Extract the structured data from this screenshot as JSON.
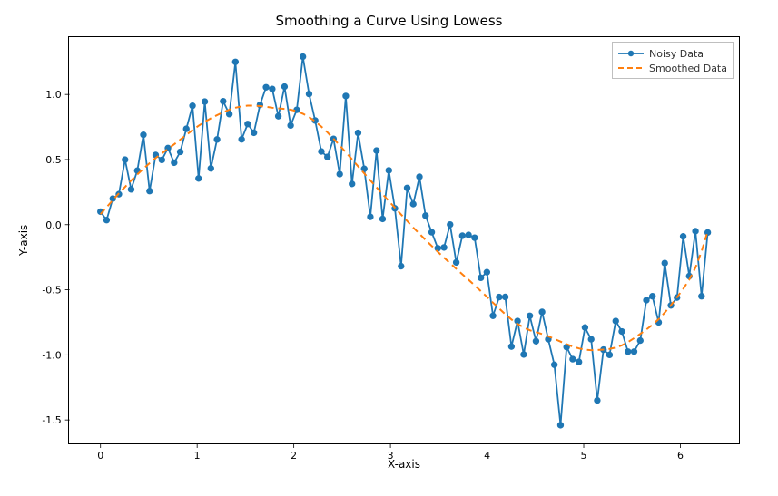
{
  "chart_data": {
    "type": "line",
    "title": "Smoothing a Curve Using Lowess",
    "xlabel": "X-axis",
    "ylabel": "Y-axis",
    "xlim": [
      -0.32,
      6.6
    ],
    "ylim": [
      -1.68,
      1.44
    ],
    "x_ticks": [
      0,
      1,
      2,
      3,
      4,
      5,
      6
    ],
    "y_ticks": [
      -1.5,
      -1.0,
      -0.5,
      0.0,
      0.5,
      1.0
    ],
    "series": [
      {
        "name": "Noisy Data",
        "style": "line+marker",
        "color": "#1f77b4",
        "x": [
          0.0,
          0.063,
          0.127,
          0.19,
          0.254,
          0.317,
          0.381,
          0.444,
          0.508,
          0.571,
          0.635,
          0.698,
          0.762,
          0.825,
          0.888,
          0.952,
          1.015,
          1.079,
          1.142,
          1.206,
          1.269,
          1.333,
          1.396,
          1.46,
          1.523,
          1.587,
          1.65,
          1.713,
          1.777,
          1.84,
          1.904,
          1.967,
          2.031,
          2.094,
          2.158,
          2.221,
          2.285,
          2.348,
          2.411,
          2.475,
          2.538,
          2.602,
          2.665,
          2.729,
          2.792,
          2.856,
          2.919,
          2.983,
          3.046,
          3.11,
          3.173,
          3.236,
          3.3,
          3.363,
          3.427,
          3.49,
          3.554,
          3.617,
          3.681,
          3.744,
          3.808,
          3.871,
          3.935,
          3.998,
          4.061,
          4.125,
          4.188,
          4.252,
          4.315,
          4.379,
          4.442,
          4.506,
          4.569,
          4.633,
          4.696,
          4.76,
          4.823,
          4.886,
          4.95,
          5.013,
          5.077,
          5.14,
          5.204,
          5.267,
          5.331,
          5.394,
          5.458,
          5.521,
          5.585,
          5.648,
          5.711,
          5.775,
          5.838,
          5.902,
          5.965,
          6.029,
          6.092,
          6.156,
          6.219,
          6.283
        ],
        "y": [
          0.1,
          0.035,
          0.2,
          0.234,
          0.499,
          0.271,
          0.415,
          0.69,
          0.258,
          0.535,
          0.497,
          0.588,
          0.476,
          0.559,
          0.736,
          0.913,
          0.355,
          0.945,
          0.432,
          0.654,
          0.948,
          0.849,
          1.25,
          0.655,
          0.773,
          0.706,
          0.92,
          1.055,
          1.042,
          0.833,
          1.06,
          0.762,
          0.882,
          1.29,
          1.004,
          0.8,
          0.562,
          0.52,
          0.659,
          0.388,
          0.988,
          0.313,
          0.705,
          0.429,
          0.06,
          0.569,
          0.044,
          0.417,
          0.125,
          -0.319,
          0.282,
          0.158,
          0.368,
          0.069,
          -0.058,
          -0.181,
          -0.175,
          0.001,
          -0.29,
          -0.085,
          -0.079,
          -0.1,
          -0.408,
          -0.365,
          -0.7,
          -0.556,
          -0.555,
          -0.936,
          -0.74,
          -0.997,
          -0.7,
          -0.895,
          -0.67,
          -0.88,
          -1.076,
          -1.54,
          -0.94,
          -1.033,
          -1.054,
          -0.79,
          -0.88,
          -1.35,
          -0.96,
          -1.0,
          -0.74,
          -0.82,
          -0.975,
          -0.975,
          -0.89,
          -0.58,
          -0.55,
          -0.75,
          -0.295,
          -0.62,
          -0.56,
          -0.09,
          -0.395,
          -0.05,
          -0.55,
          -0.06
        ]
      },
      {
        "name": "Smoothed Data",
        "style": "dashed",
        "color": "#ff7f0e",
        "x": [
          0.0,
          0.063,
          0.127,
          0.19,
          0.254,
          0.317,
          0.381,
          0.444,
          0.508,
          0.571,
          0.635,
          0.698,
          0.762,
          0.825,
          0.888,
          0.952,
          1.015,
          1.079,
          1.142,
          1.206,
          1.269,
          1.333,
          1.396,
          1.46,
          1.523,
          1.587,
          1.65,
          1.713,
          1.777,
          1.84,
          1.904,
          1.967,
          2.031,
          2.094,
          2.158,
          2.221,
          2.285,
          2.348,
          2.411,
          2.475,
          2.538,
          2.602,
          2.665,
          2.729,
          2.792,
          2.856,
          2.919,
          2.983,
          3.046,
          3.11,
          3.173,
          3.236,
          3.3,
          3.363,
          3.427,
          3.49,
          3.554,
          3.617,
          3.681,
          3.744,
          3.808,
          3.871,
          3.935,
          3.998,
          4.061,
          4.125,
          4.188,
          4.252,
          4.315,
          4.379,
          4.442,
          4.506,
          4.569,
          4.633,
          4.696,
          4.76,
          4.823,
          4.886,
          4.95,
          5.013,
          5.077,
          5.14,
          5.204,
          5.267,
          5.331,
          5.394,
          5.458,
          5.521,
          5.585,
          5.648,
          5.711,
          5.775,
          5.838,
          5.902,
          5.965,
          6.029,
          6.092,
          6.156,
          6.219,
          6.283
        ],
        "y": [
          0.08,
          0.134,
          0.188,
          0.24,
          0.29,
          0.339,
          0.386,
          0.43,
          0.472,
          0.512,
          0.548,
          0.582,
          0.617,
          0.653,
          0.69,
          0.726,
          0.76,
          0.79,
          0.817,
          0.841,
          0.863,
          0.883,
          0.898,
          0.908,
          0.914,
          0.914,
          0.911,
          0.905,
          0.898,
          0.893,
          0.889,
          0.883,
          0.871,
          0.852,
          0.826,
          0.793,
          0.753,
          0.709,
          0.66,
          0.609,
          0.556,
          0.502,
          0.448,
          0.394,
          0.34,
          0.287,
          0.234,
          0.181,
          0.13,
          0.078,
          0.028,
          -0.022,
          -0.07,
          -0.117,
          -0.163,
          -0.209,
          -0.253,
          -0.296,
          -0.339,
          -0.381,
          -0.423,
          -0.466,
          -0.51,
          -0.554,
          -0.599,
          -0.644,
          -0.688,
          -0.728,
          -0.762,
          -0.79,
          -0.811,
          -0.825,
          -0.84,
          -0.857,
          -0.877,
          -0.898,
          -0.918,
          -0.936,
          -0.95,
          -0.96,
          -0.964,
          -0.962,
          -0.959,
          -0.954,
          -0.944,
          -0.927,
          -0.902,
          -0.872,
          -0.839,
          -0.805,
          -0.769,
          -0.726,
          -0.675,
          -0.619,
          -0.558,
          -0.493,
          -0.422,
          -0.33,
          -0.205,
          -0.05
        ]
      }
    ],
    "legend": {
      "position": "upper-right",
      "items": [
        "Noisy Data",
        "Smoothed Data"
      ]
    }
  }
}
